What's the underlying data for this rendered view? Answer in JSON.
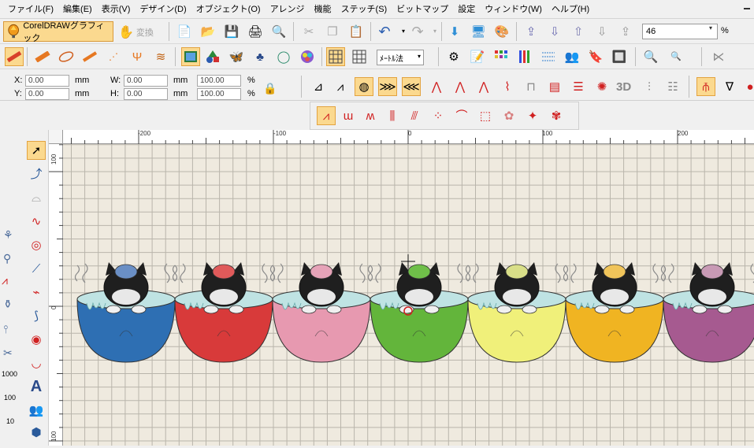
{
  "menu": [
    "ファイル(F)",
    "編集(E)",
    "表示(V)",
    "デザイン(D)",
    "オブジェクト(O)",
    "アレンジ",
    "機能",
    "ステッチ(S)",
    "ビットマップ",
    "設定",
    "ウィンドウ(W)",
    "ヘルプ(H)"
  ],
  "toolbar": {
    "corel_label": "CorelDRAWグラフィック",
    "transform_label": "変換",
    "zoom_value": "46",
    "zoom_unit": "%",
    "unit_value": "ﾒｰﾄﾙ法"
  },
  "coords": {
    "x_label": "X:",
    "x_value": "0.00",
    "x_unit": "mm",
    "y_label": "Y:",
    "y_value": "0.00",
    "y_unit": "mm",
    "w_label": "W:",
    "w_value": "0.00",
    "w_unit": "mm",
    "h_label": "H:",
    "h_value": "0.00",
    "h_unit": "mm",
    "sx_value": "100.00",
    "sx_unit": "%",
    "sy_value": "100.00",
    "sy_unit": "%"
  },
  "ruler": {
    "top": [
      "-200",
      "-100",
      "0",
      "100",
      "200"
    ],
    "left": [
      "100",
      "0",
      "100"
    ]
  },
  "toolbox_text": {
    "label_3d": "3D",
    "size1000": "1000",
    "size100": "100",
    "size10": "10",
    "text_tool": "A"
  },
  "designs": [
    {
      "name": "blue",
      "cup": "#2e6fb3",
      "head": "#6a8fc5"
    },
    {
      "name": "red",
      "cup": "#d83a3a",
      "head": "#e05a5a"
    },
    {
      "name": "pink",
      "cup": "#e799b0",
      "head": "#e6a3b8"
    },
    {
      "name": "green",
      "cup": "#63b53b",
      "head": "#6fbf49"
    },
    {
      "name": "yellow",
      "cup": "#f0f07a",
      "head": "#d9df88"
    },
    {
      "name": "orange",
      "cup": "#f0b422",
      "head": "#f0c45a"
    },
    {
      "name": "purple",
      "cup": "#a65a90",
      "head": "#c89ab5"
    }
  ]
}
